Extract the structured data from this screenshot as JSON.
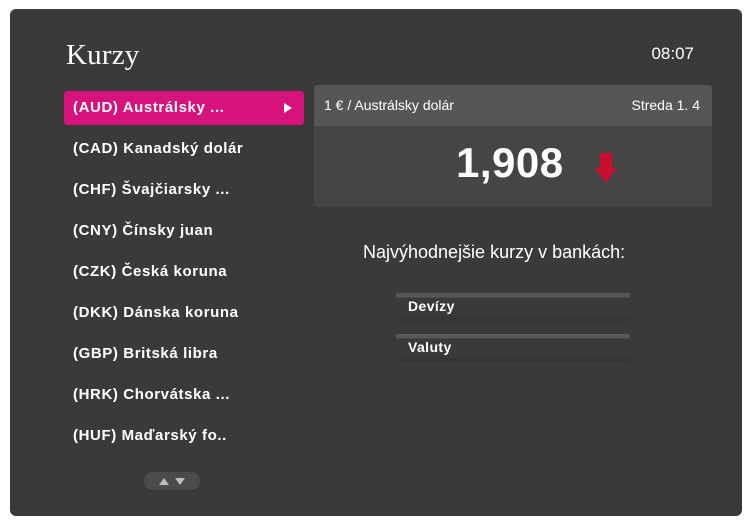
{
  "header": {
    "title": "Kurzy",
    "time": "08:07"
  },
  "currency_list": {
    "items": [
      {
        "label": "(AUD) Austrálsky ...",
        "selected": true
      },
      {
        "label": "(CAD) Kanadský dolár",
        "selected": false
      },
      {
        "label": "(CHF) Švajčiarsky ...",
        "selected": false
      },
      {
        "label": "(CNY) Čínsky juan",
        "selected": false
      },
      {
        "label": "(CZK) Česká koruna",
        "selected": false
      },
      {
        "label": "(DKK) Dánska koruna",
        "selected": false
      },
      {
        "label": "(GBP) Britská libra",
        "selected": false
      },
      {
        "label": "(HRK) Chorvátska ...",
        "selected": false
      },
      {
        "label": "(HUF) Maďarský fo..",
        "selected": false
      }
    ],
    "scroll_icons": [
      "arrow-up-icon",
      "arrow-down-icon"
    ]
  },
  "rate_panel": {
    "pair_label": "1 € / Austrálsky dolár",
    "date": "Streda 1. 4",
    "value": "1,908",
    "trend": "down",
    "trend_icon": "arrow-down-icon",
    "trend_color": "#c8102e"
  },
  "banks": {
    "title": "Najvýhodnejšie kurzy v bankách:",
    "rows": [
      {
        "label": "Devízy"
      },
      {
        "label": "Valuty"
      }
    ]
  },
  "colors": {
    "accent": "#d6127c",
    "background": "#3a3a3a"
  }
}
